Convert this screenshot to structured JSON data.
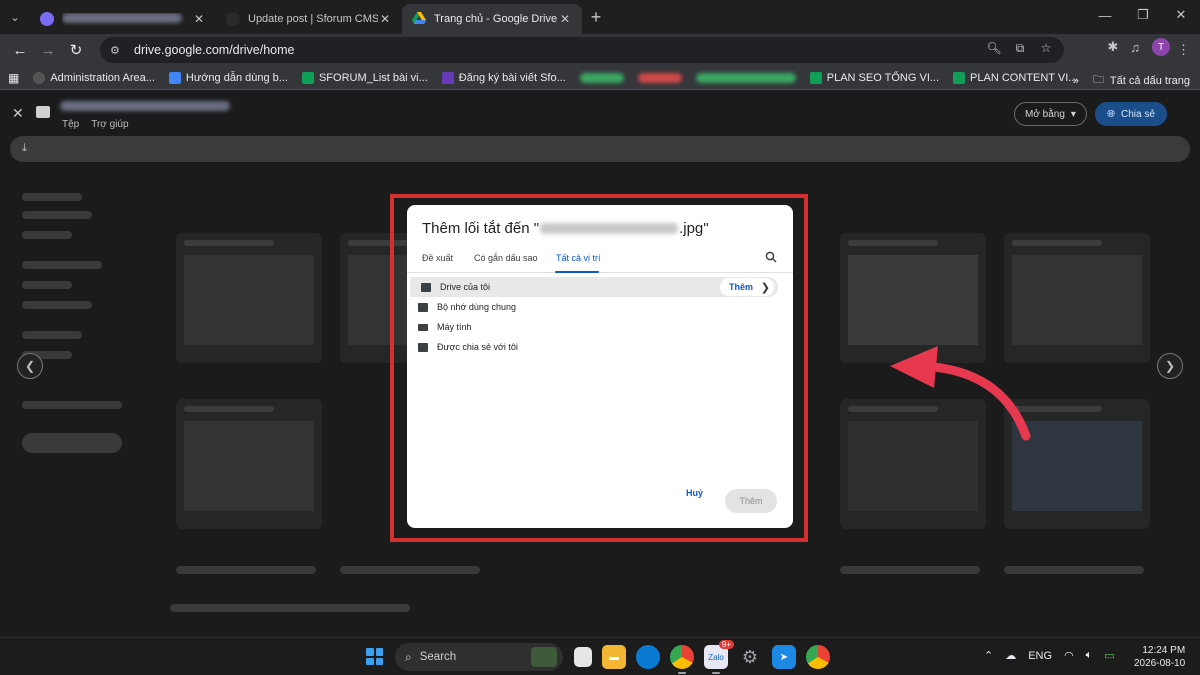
{
  "browser": {
    "tabs": [
      {
        "title": "",
        "blurred": true,
        "color": "#7b6cf6"
      },
      {
        "title": "Update post | Sforum CMS",
        "blurred": false,
        "color": "#2a2a2a"
      },
      {
        "title": "Trang chủ - Google Drive",
        "blurred": false,
        "color": "#34a853",
        "active": true
      }
    ],
    "url": "drive.google.com/drive/home",
    "avatar_letter": "T",
    "bookmarks": [
      {
        "label": "Administration Area...",
        "color": "#555"
      },
      {
        "label": "Hướng dẫn dùng b...",
        "color": "#4285f4"
      },
      {
        "label": "SFORUM_List bài vi...",
        "color": "#0f9d58"
      },
      {
        "label": "Đăng ký bài viết Sfo...",
        "color": "#673ab7"
      },
      {
        "label": "PLAN SEO TỔNG VI...",
        "color": "#0f9d58"
      },
      {
        "label": "PLAN CONTENT VI...",
        "color": "#0f9d58"
      }
    ],
    "all_bookmarks": "Tất cả dấu trang"
  },
  "viewer": {
    "menu": [
      "Tệp",
      "Trợ giúp"
    ],
    "open_with": "Mở bằng",
    "share": "Chia sẻ"
  },
  "dialog": {
    "title_prefix": "Thêm lối tắt đến \"",
    "title_suffix": ".jpg\"",
    "tabs": [
      "Đề xuất",
      "Có gắn dấu sao",
      "Tất cả vị trí"
    ],
    "active_tab": "Tất cả vị trí",
    "locations": [
      {
        "label": "Drive của tôi",
        "icon": "my-drive-icon",
        "selected": true
      },
      {
        "label": "Bộ nhớ dùng chung",
        "icon": "shared-drives-icon"
      },
      {
        "label": "Máy tính",
        "icon": "computer-icon"
      },
      {
        "label": "Được chia sẻ với tôi",
        "icon": "shared-with-me-icon"
      }
    ],
    "row_add_label": "Thêm",
    "cancel_label": "Huỷ",
    "add_label": "Thêm"
  },
  "taskbar": {
    "search_placeholder": "Search",
    "language": "ENG",
    "time": "12:24 PM",
    "date": "2026-08-10",
    "badge": "9+"
  },
  "colors": {
    "highlight": "#d32f2f",
    "arrow": "#e8384f",
    "accent": "#0b57d0"
  }
}
